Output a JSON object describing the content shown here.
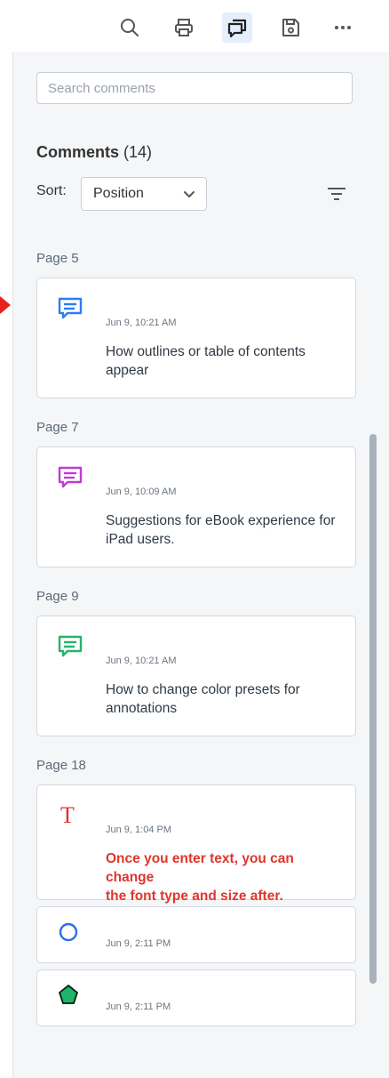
{
  "toolbar": {
    "buttons": [
      {
        "icon": "search-icon"
      },
      {
        "icon": "print-icon"
      },
      {
        "icon": "comments-icon",
        "active": true
      },
      {
        "icon": "save-icon"
      },
      {
        "icon": "more-icon"
      }
    ]
  },
  "search": {
    "placeholder": "Search comments",
    "value": ""
  },
  "comments": {
    "title": "Comments",
    "count": "(14)"
  },
  "sort": {
    "label": "Sort:",
    "value": "Position"
  },
  "pages": [
    {
      "label": "Page 5",
      "comments": [
        {
          "icon": "note-icon",
          "color": "#2d7ef2",
          "date": "Jun 9, 10:21 AM",
          "text": "How outlines or table of contents appear"
        }
      ]
    },
    {
      "label": "Page 7",
      "comments": [
        {
          "icon": "note-icon",
          "color": "#c23bd4",
          "date": "Jun 9, 10:09 AM",
          "text": "Suggestions for eBook experience for iPad users."
        }
      ]
    },
    {
      "label": "Page 9",
      "comments": [
        {
          "icon": "note-icon",
          "color": "#25b566",
          "date": "Jun 9, 10:21 AM",
          "text": "How to change color presets for annotations"
        }
      ]
    },
    {
      "label": "Page 18",
      "comments": [
        {
          "icon": "text-icon",
          "color": "#e0352b",
          "date": "Jun 9, 1:04 PM",
          "text": "Once you enter text, you can change\nthe font type and size after."
        },
        {
          "icon": "circle-icon",
          "color": "#2d6fe6",
          "date": "Jun 9, 2:11 PM",
          "text": ""
        },
        {
          "icon": "pentagon-icon",
          "color": "#1fb46b",
          "date": "Jun 9, 2:11 PM",
          "text": ""
        }
      ]
    }
  ],
  "colors": {
    "accent": "#2d7ef2",
    "marker": "#e8221b",
    "active_bg": "#e4eefc"
  }
}
